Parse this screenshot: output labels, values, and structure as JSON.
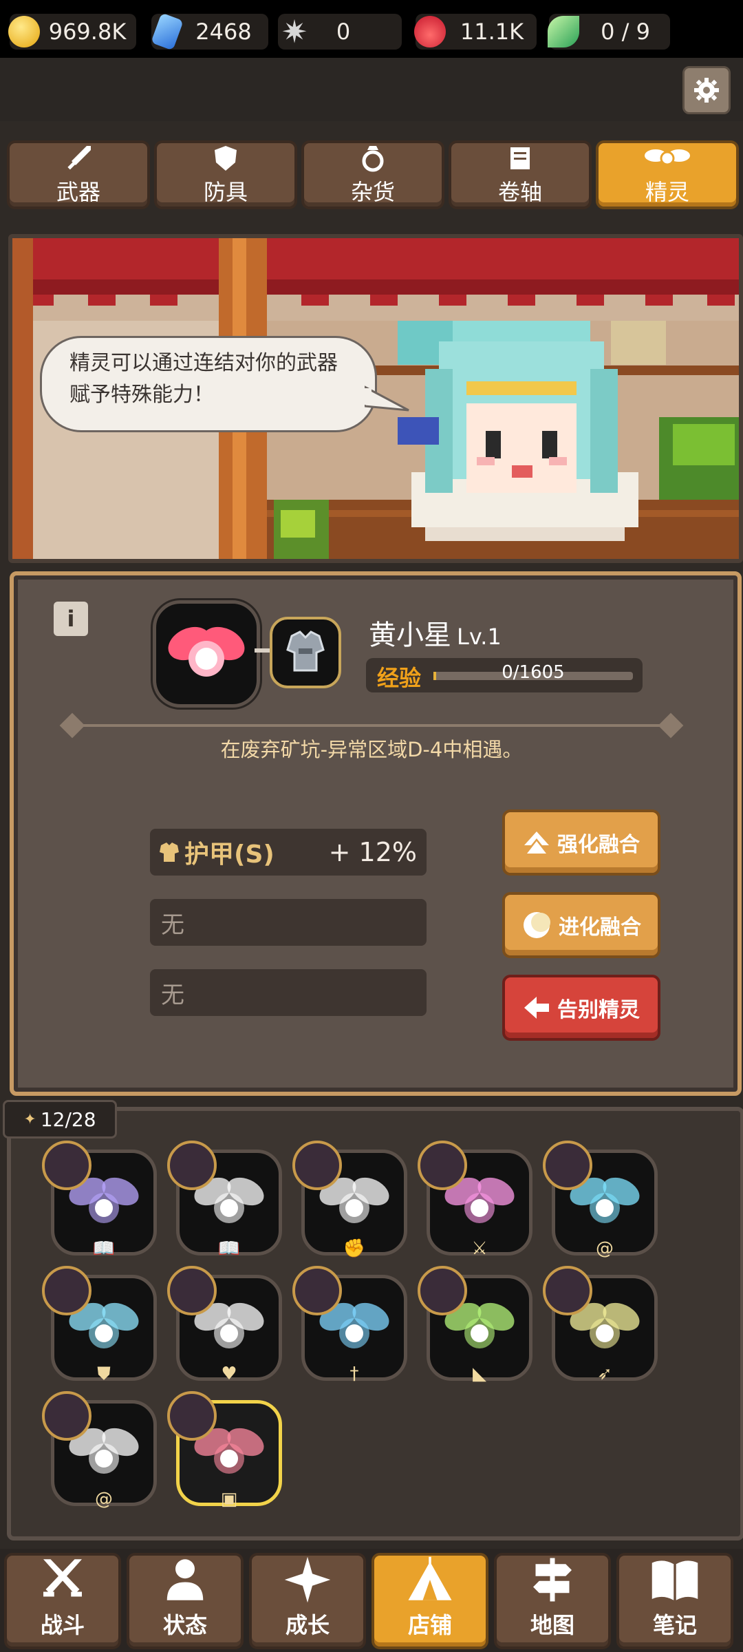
{
  "resources": [
    {
      "icon": "gold-coin-icon",
      "value": "969.8K"
    },
    {
      "icon": "blue-gem-icon",
      "value": "2468"
    },
    {
      "icon": "star-shard-icon",
      "value": "0"
    },
    {
      "icon": "red-flame-icon",
      "value": "11.1K"
    },
    {
      "icon": "green-leaf-icon",
      "value": "0 / 9"
    }
  ],
  "tabs": [
    {
      "label": "武器",
      "icon": "sword-icon"
    },
    {
      "label": "防具",
      "icon": "shield-icon"
    },
    {
      "label": "杂货",
      "icon": "ring-icon"
    },
    {
      "label": "卷轴",
      "icon": "scroll-icon"
    },
    {
      "label": "精灵",
      "icon": "fairy-wings-icon",
      "active": true
    }
  ],
  "banner": {
    "speech": "精灵可以通过连结对你的武器赋予特殊能力！"
  },
  "fairy": {
    "name": "黄小星",
    "level": "Lv.1",
    "exp_label": "经验",
    "exp_value": "0/1605",
    "exp_fraction": 0.0,
    "location": "在废弃矿坑-异常区域D-4中相遇。"
  },
  "stats": [
    {
      "label": "护甲(S)",
      "value": "+ 12%"
    },
    {
      "label": "无",
      "value": ""
    },
    {
      "label": "无",
      "value": ""
    }
  ],
  "actions": {
    "enhance": "强化融合",
    "evolve": "进化融合",
    "farewell": "告别精灵"
  },
  "collection": {
    "count": "12/28",
    "slots": [
      {
        "orb_color": "#b9a6ff",
        "type_icon": "book-icon"
      },
      {
        "orb_color": "#ffffff",
        "type_icon": "book-icon"
      },
      {
        "orb_color": "#ffffff",
        "type_icon": "fist-icon"
      },
      {
        "orb_color": "#ff9ae8",
        "type_icon": "sword-target-icon"
      },
      {
        "orb_color": "#7fe3ff",
        "type_icon": "swirl-icon"
      },
      {
        "orb_color": "#8fe6ff",
        "type_icon": "shield-icon"
      },
      {
        "orb_color": "#ffffff",
        "type_icon": "heart-icon"
      },
      {
        "orb_color": "#7fd6ff",
        "type_icon": "sword-icon"
      },
      {
        "orb_color": "#b6f57a",
        "type_icon": "boot-icon"
      },
      {
        "orb_color": "#f3ef9a",
        "type_icon": "arrow-icon"
      },
      {
        "orb_color": "#ffffff",
        "type_icon": "swirl-icon"
      },
      {
        "orb_color": "#ff8aa0",
        "type_icon": "armor-icon",
        "selected": true
      }
    ]
  },
  "nav": [
    {
      "label": "战斗",
      "icon": "crossed-swords-icon"
    },
    {
      "label": "状态",
      "icon": "person-icon"
    },
    {
      "label": "成长",
      "icon": "sparkle-icon"
    },
    {
      "label": "店铺",
      "icon": "tent-icon",
      "active": true
    },
    {
      "label": "地图",
      "icon": "signpost-icon"
    },
    {
      "label": "笔记",
      "icon": "open-book-icon"
    }
  ]
}
